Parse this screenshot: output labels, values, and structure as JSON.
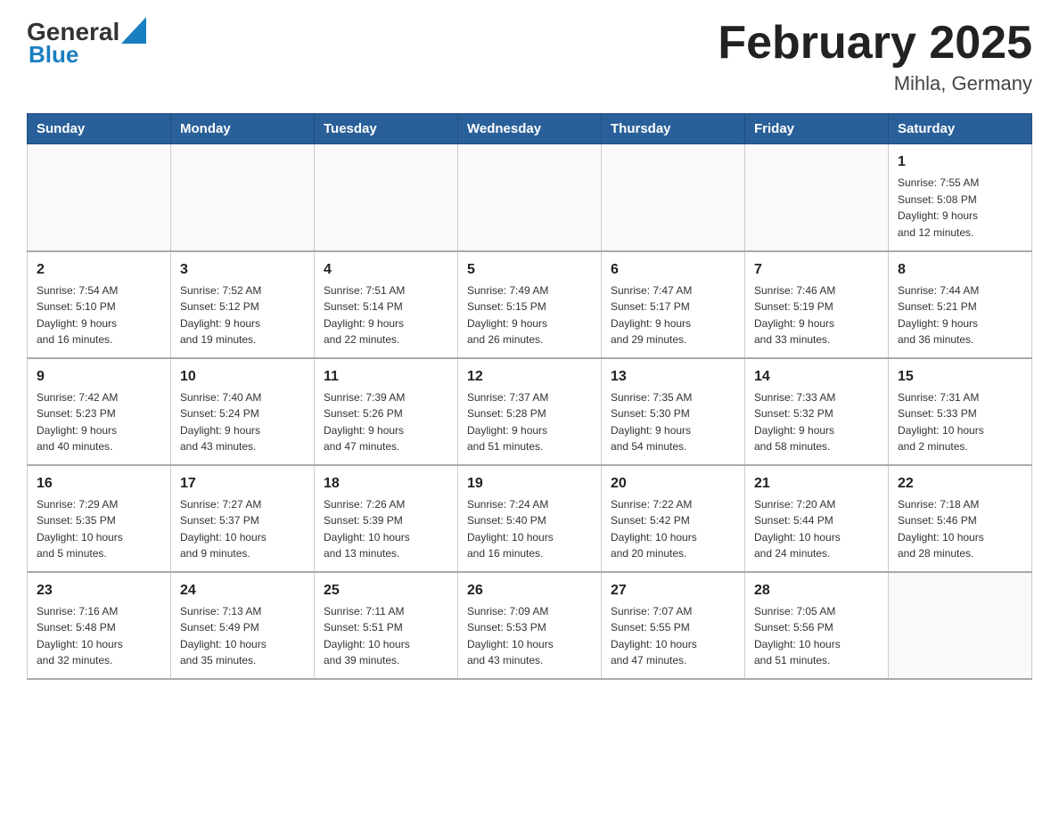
{
  "header": {
    "logo_general": "General",
    "logo_blue": "Blue",
    "title": "February 2025",
    "subtitle": "Mihla, Germany"
  },
  "weekdays": [
    "Sunday",
    "Monday",
    "Tuesday",
    "Wednesday",
    "Thursday",
    "Friday",
    "Saturday"
  ],
  "weeks": [
    [
      {
        "day": "",
        "info": ""
      },
      {
        "day": "",
        "info": ""
      },
      {
        "day": "",
        "info": ""
      },
      {
        "day": "",
        "info": ""
      },
      {
        "day": "",
        "info": ""
      },
      {
        "day": "",
        "info": ""
      },
      {
        "day": "1",
        "info": "Sunrise: 7:55 AM\nSunset: 5:08 PM\nDaylight: 9 hours\nand 12 minutes."
      }
    ],
    [
      {
        "day": "2",
        "info": "Sunrise: 7:54 AM\nSunset: 5:10 PM\nDaylight: 9 hours\nand 16 minutes."
      },
      {
        "day": "3",
        "info": "Sunrise: 7:52 AM\nSunset: 5:12 PM\nDaylight: 9 hours\nand 19 minutes."
      },
      {
        "day": "4",
        "info": "Sunrise: 7:51 AM\nSunset: 5:14 PM\nDaylight: 9 hours\nand 22 minutes."
      },
      {
        "day": "5",
        "info": "Sunrise: 7:49 AM\nSunset: 5:15 PM\nDaylight: 9 hours\nand 26 minutes."
      },
      {
        "day": "6",
        "info": "Sunrise: 7:47 AM\nSunset: 5:17 PM\nDaylight: 9 hours\nand 29 minutes."
      },
      {
        "day": "7",
        "info": "Sunrise: 7:46 AM\nSunset: 5:19 PM\nDaylight: 9 hours\nand 33 minutes."
      },
      {
        "day": "8",
        "info": "Sunrise: 7:44 AM\nSunset: 5:21 PM\nDaylight: 9 hours\nand 36 minutes."
      }
    ],
    [
      {
        "day": "9",
        "info": "Sunrise: 7:42 AM\nSunset: 5:23 PM\nDaylight: 9 hours\nand 40 minutes."
      },
      {
        "day": "10",
        "info": "Sunrise: 7:40 AM\nSunset: 5:24 PM\nDaylight: 9 hours\nand 43 minutes."
      },
      {
        "day": "11",
        "info": "Sunrise: 7:39 AM\nSunset: 5:26 PM\nDaylight: 9 hours\nand 47 minutes."
      },
      {
        "day": "12",
        "info": "Sunrise: 7:37 AM\nSunset: 5:28 PM\nDaylight: 9 hours\nand 51 minutes."
      },
      {
        "day": "13",
        "info": "Sunrise: 7:35 AM\nSunset: 5:30 PM\nDaylight: 9 hours\nand 54 minutes."
      },
      {
        "day": "14",
        "info": "Sunrise: 7:33 AM\nSunset: 5:32 PM\nDaylight: 9 hours\nand 58 minutes."
      },
      {
        "day": "15",
        "info": "Sunrise: 7:31 AM\nSunset: 5:33 PM\nDaylight: 10 hours\nand 2 minutes."
      }
    ],
    [
      {
        "day": "16",
        "info": "Sunrise: 7:29 AM\nSunset: 5:35 PM\nDaylight: 10 hours\nand 5 minutes."
      },
      {
        "day": "17",
        "info": "Sunrise: 7:27 AM\nSunset: 5:37 PM\nDaylight: 10 hours\nand 9 minutes."
      },
      {
        "day": "18",
        "info": "Sunrise: 7:26 AM\nSunset: 5:39 PM\nDaylight: 10 hours\nand 13 minutes."
      },
      {
        "day": "19",
        "info": "Sunrise: 7:24 AM\nSunset: 5:40 PM\nDaylight: 10 hours\nand 16 minutes."
      },
      {
        "day": "20",
        "info": "Sunrise: 7:22 AM\nSunset: 5:42 PM\nDaylight: 10 hours\nand 20 minutes."
      },
      {
        "day": "21",
        "info": "Sunrise: 7:20 AM\nSunset: 5:44 PM\nDaylight: 10 hours\nand 24 minutes."
      },
      {
        "day": "22",
        "info": "Sunrise: 7:18 AM\nSunset: 5:46 PM\nDaylight: 10 hours\nand 28 minutes."
      }
    ],
    [
      {
        "day": "23",
        "info": "Sunrise: 7:16 AM\nSunset: 5:48 PM\nDaylight: 10 hours\nand 32 minutes."
      },
      {
        "day": "24",
        "info": "Sunrise: 7:13 AM\nSunset: 5:49 PM\nDaylight: 10 hours\nand 35 minutes."
      },
      {
        "day": "25",
        "info": "Sunrise: 7:11 AM\nSunset: 5:51 PM\nDaylight: 10 hours\nand 39 minutes."
      },
      {
        "day": "26",
        "info": "Sunrise: 7:09 AM\nSunset: 5:53 PM\nDaylight: 10 hours\nand 43 minutes."
      },
      {
        "day": "27",
        "info": "Sunrise: 7:07 AM\nSunset: 5:55 PM\nDaylight: 10 hours\nand 47 minutes."
      },
      {
        "day": "28",
        "info": "Sunrise: 7:05 AM\nSunset: 5:56 PM\nDaylight: 10 hours\nand 51 minutes."
      },
      {
        "day": "",
        "info": ""
      }
    ]
  ],
  "colors": {
    "header_bg": "#2a6099",
    "header_text": "#ffffff",
    "border": "#bbbbbb"
  }
}
